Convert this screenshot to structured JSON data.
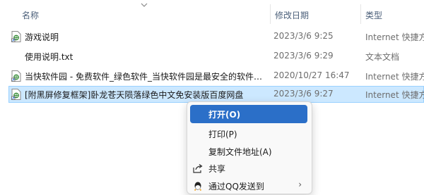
{
  "columns": {
    "name": "名称",
    "date_modified": "修改日期",
    "type": "类型"
  },
  "files": [
    {
      "name": "游戏说明",
      "date": "2023/3/6 9:25",
      "type": "Internet 快捷方式",
      "icon": "internet-shortcut-icon",
      "selected": false
    },
    {
      "name": "使用说明.txt",
      "date": "2023/3/6 9:29",
      "type": "文本文档",
      "icon": "text-file-icon",
      "selected": false
    },
    {
      "name": "当快软件园 - 免费软件_绿色软件_当快软件园是最安全的软件官方下载...",
      "date": "2020/10/27 16:47",
      "type": "Internet 快捷方式",
      "icon": "internet-shortcut-icon",
      "selected": false
    },
    {
      "name": "[附黑屏修复框架]卧龙苍天陨落绿色中文免安装版百度网盘",
      "date": "2023/3/6 9:27",
      "type": "Internet 快捷方式",
      "icon": "internet-shortcut-icon",
      "selected": true
    }
  ],
  "context_menu": {
    "items": [
      {
        "label": "打开(O)",
        "active": true
      },
      {
        "label": "打印(P)",
        "active": false
      },
      {
        "label": "复制文件地址(A)",
        "active": false
      },
      {
        "label": "共享",
        "icon": "share-icon",
        "active": false
      },
      {
        "label": "通过QQ发送到",
        "icon": "qq-icon",
        "has_submenu": true,
        "active": false
      }
    ]
  },
  "colors": {
    "selection_bg": "#cce8ff",
    "selection_border": "#99d1ff",
    "menu_active": "#2b6fc8",
    "header_text": "#4c607a"
  }
}
